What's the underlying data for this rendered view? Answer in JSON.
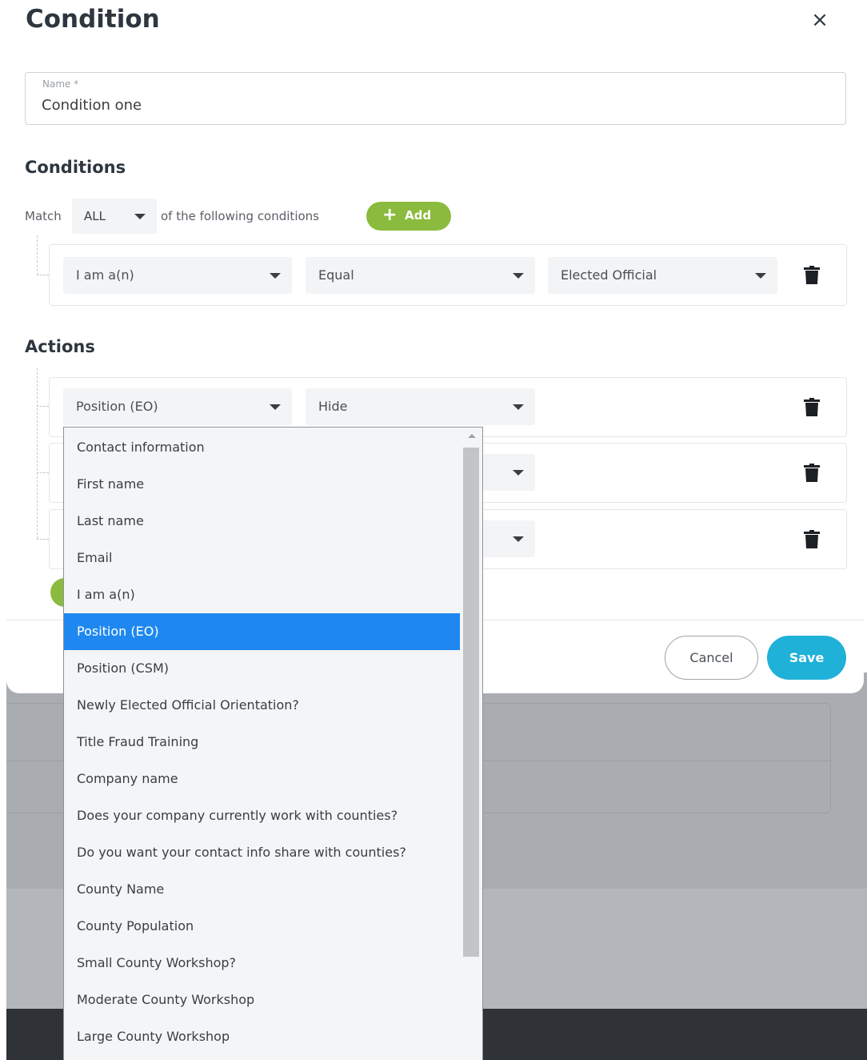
{
  "dialog": {
    "title": "Condition",
    "close_icon": "×"
  },
  "name_field": {
    "label": "Name *",
    "value": "Condition one"
  },
  "conditions": {
    "heading": "Conditions",
    "match_label": "Match",
    "match_value": "ALL",
    "following_text": "of the following conditions",
    "add_button": {
      "icon": "+",
      "label": "Add",
      "color": "#8bbb3e"
    },
    "rows": [
      {
        "field": "I am a(n)",
        "operator": "Equal",
        "value": "Elected Official"
      }
    ]
  },
  "actions": {
    "heading": "Actions",
    "rows": [
      {
        "field": "Position (EO)",
        "action": "Hide"
      }
    ]
  },
  "footer": {
    "cancel_label": "Cancel",
    "save_label": "Save",
    "save_color": "#1fb1d8"
  },
  "dropdown": {
    "selected_index": 5,
    "selected_color": "#1e88f0",
    "options": [
      "Contact information",
      "First name",
      "Last name",
      "Email",
      "I am a(n)",
      "Position (EO)",
      "Position (CSM)",
      "Newly Elected Official Orientation?",
      "Title Fraud Training",
      "Company name",
      "Does your company currently work with counties?",
      "Do you want your contact info share with counties?",
      "County Name",
      "County Population",
      "Small County Workshop?",
      "Moderate County Workshop",
      "Large County Workshop"
    ]
  }
}
